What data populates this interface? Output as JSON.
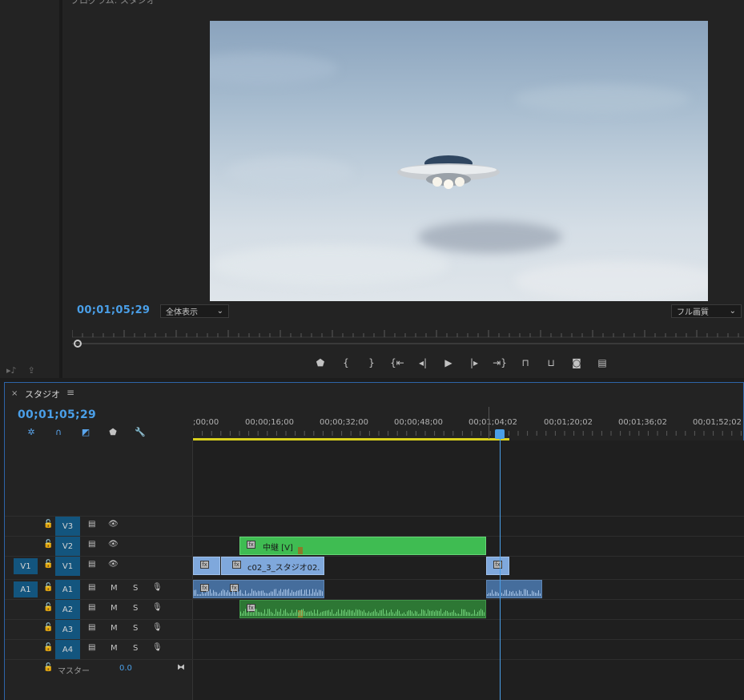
{
  "monitor": {
    "title": "プログラム: スタジオ",
    "timecode": "00;01;05;29",
    "zoom": "全体表示",
    "quality": "フル画質"
  },
  "timeline": {
    "tab_title": "スタジオ",
    "timecode": "00;01;05;29",
    "ruler_labels": [
      ";00;00",
      "00;00;16;00",
      "00;00;32;00",
      "00;00;48;00",
      "00;01;04;02",
      "00;01;20;02",
      "00;01;36;02",
      "00;01;52;02"
    ],
    "tracks": {
      "video": [
        {
          "id": "V3",
          "target": "V3"
        },
        {
          "id": "V2",
          "target": "V2"
        },
        {
          "id": "V1",
          "source": "V1",
          "target": "V1"
        }
      ],
      "audio": [
        {
          "id": "A1",
          "source": "A1",
          "target": "A1",
          "m": "M",
          "s": "S"
        },
        {
          "id": "A2",
          "target": "A2",
          "m": "M",
          "s": "S"
        },
        {
          "id": "A3",
          "target": "A3",
          "m": "M",
          "s": "S"
        },
        {
          "id": "A4",
          "target": "A4",
          "m": "M",
          "s": "S"
        }
      ],
      "master": {
        "label": "マスター",
        "value": "0.0"
      }
    },
    "clips": {
      "v2_clip": "中継 [V]",
      "v1_clip": "c02_3_スタジオ02."
    }
  },
  "colors": {
    "accent": "#4a9fe8",
    "track_target": "#13557e",
    "video_clip": "#7fa8dc",
    "green_clip": "#3fbc52",
    "work_bar": "#d8cf1e"
  },
  "icons": [
    "marker-icon",
    "mark-in-icon",
    "mark-out-icon",
    "go-to-in-icon",
    "step-back-icon",
    "play-icon",
    "step-forward-icon",
    "go-to-out-icon",
    "lift-icon",
    "extract-icon",
    "camera-icon",
    "compare-icon",
    "lock-icon",
    "eye-icon",
    "mic-icon",
    "wrench-icon",
    "magnet-icon"
  ]
}
